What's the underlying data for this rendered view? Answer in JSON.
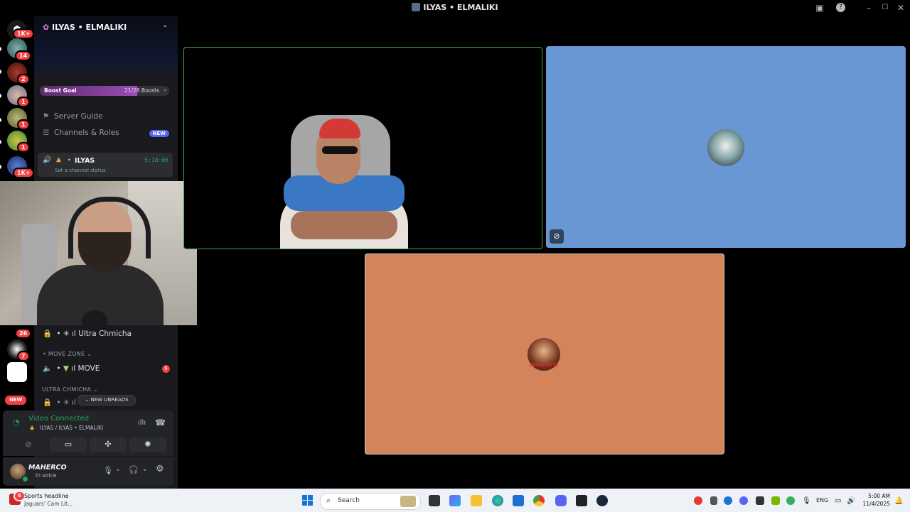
{
  "window": {
    "title": "ILYAS • ELMALIKI"
  },
  "server_rail": {
    "badges": [
      "1K+",
      "14",
      "2",
      "1",
      "1",
      "1",
      "1K+",
      "26",
      "7",
      "NEW"
    ]
  },
  "sidebar": {
    "server_name": "ILYAS • ELMALIKI",
    "boost": {
      "label": "Boost Goal",
      "count": "21/28 Boosts",
      "progress": 0.75
    },
    "server_guide": "Server Guide",
    "channels_roles": "Channels & Roles",
    "new_tag": "NEW",
    "voice_channel": {
      "name": "ILYAS",
      "time": "5:18:06",
      "status": "Set a channel status"
    },
    "lower_channels": [
      {
        "name": "Ultra Chmicha"
      },
      {
        "category": "MOVE ZONE"
      },
      {
        "name": "MOVE",
        "badge": "6"
      },
      {
        "category": "ULTRA CHMICHA"
      }
    ],
    "new_unreads": "NEW UNREADS"
  },
  "voice_panel": {
    "title": "Video Connected",
    "subtitle": "ILYAS / ILYAS • ELMALIKI"
  },
  "user_panel": {
    "username": "MAHERCO",
    "status": "In voice"
  },
  "video_grid": {
    "tiles": [
      {
        "type": "camera"
      },
      {
        "type": "avatar",
        "color": "#6997d3"
      },
      {
        "type": "avatar",
        "color": "#d4845a",
        "avatar_text": "MAHERCO"
      }
    ]
  },
  "taskbar": {
    "news_title": "Sports headline",
    "news_sub": "Jaguars' Cam Lit...",
    "news_badge": "6",
    "search_placeholder": "Search",
    "lang": "ENG",
    "time": "5:00 AM",
    "date": "11/4/2025"
  }
}
